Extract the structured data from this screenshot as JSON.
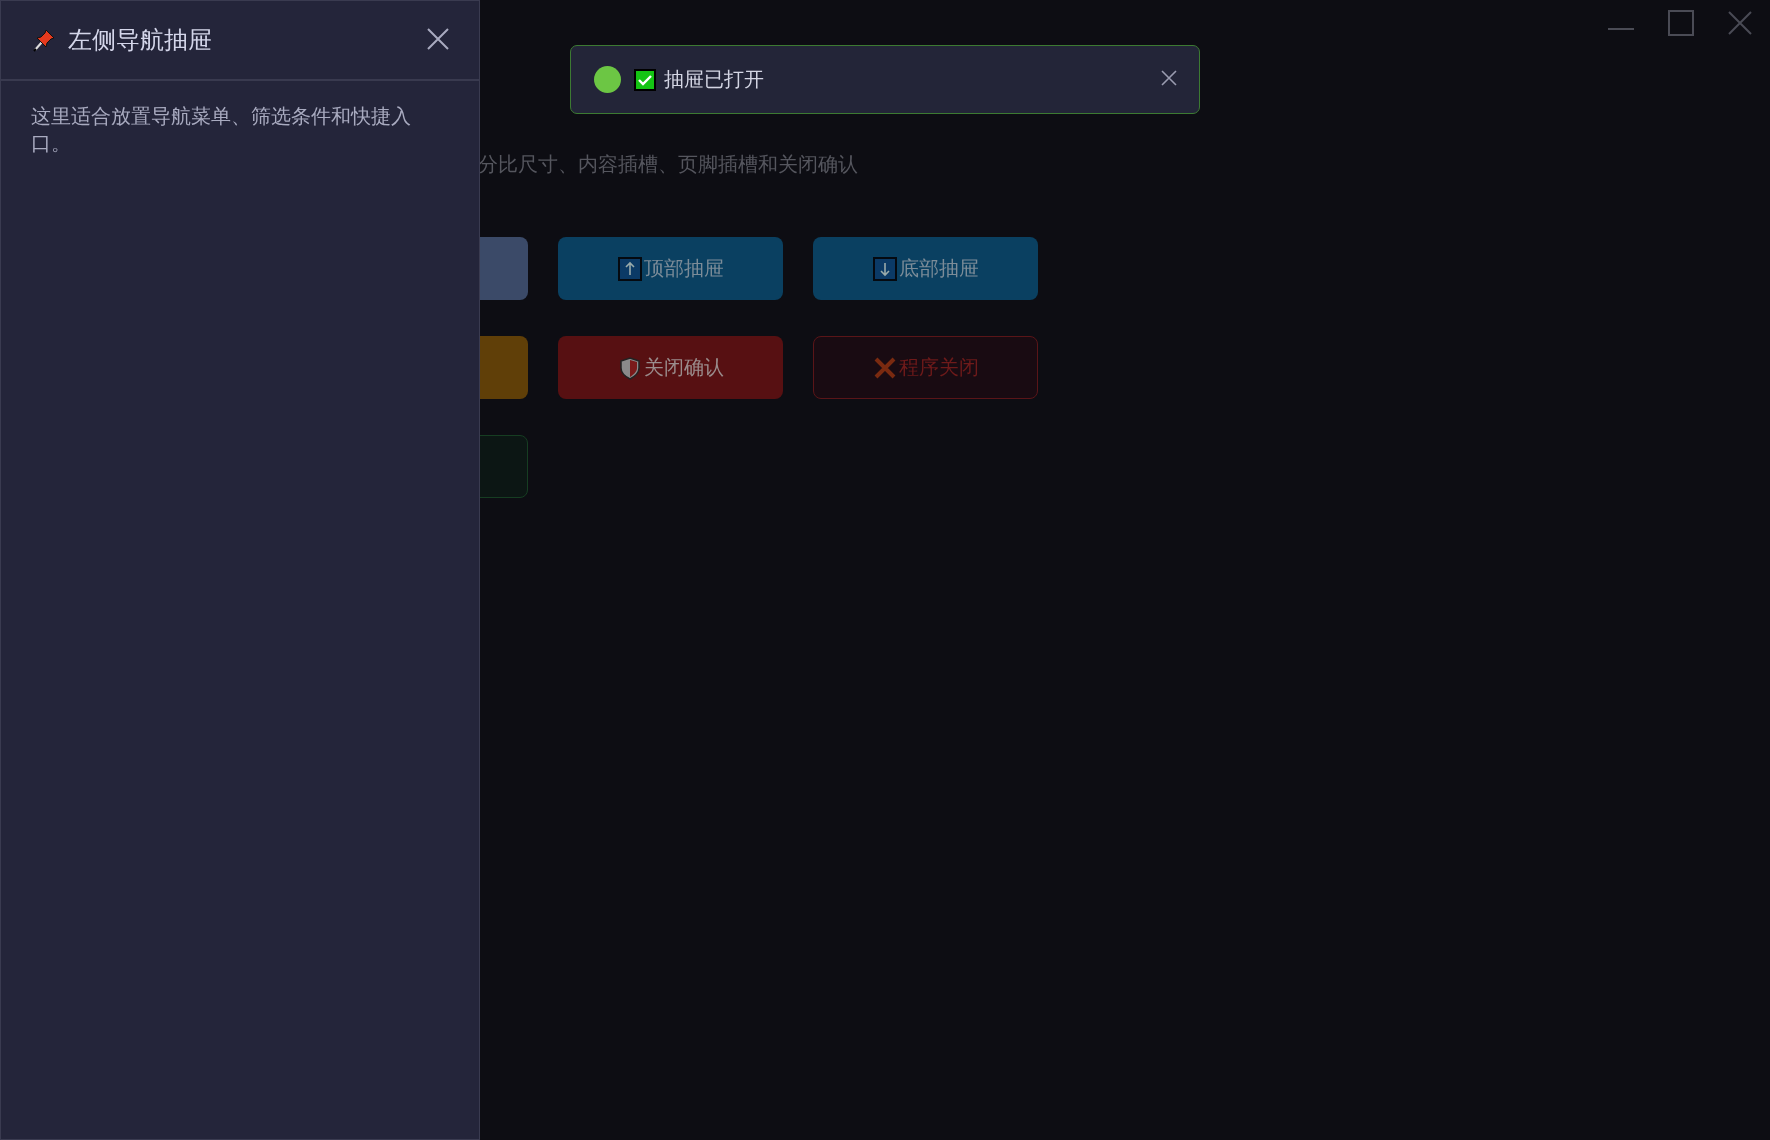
{
  "page": {
    "subtitle": "分比尺寸、内容插槽、页脚插槽和关闭确认",
    "buttons": [
      {
        "kind": "slate"
      },
      {
        "kind": "info",
        "label": "顶部抽屉"
      },
      {
        "kind": "info",
        "label": "底部抽屉"
      },
      {
        "kind": "warning"
      },
      {
        "kind": "danger",
        "label": "关闭确认"
      },
      {
        "kind": "danger-outline",
        "label": "程序关闭"
      },
      {
        "kind": "success-outline"
      }
    ]
  },
  "toast": {
    "kind": "success",
    "message": "抽屉已打开"
  },
  "drawer": {
    "title": "左侧导航抽屉",
    "body": "这里适合放置导航菜单、筛选条件和快捷入口。"
  }
}
